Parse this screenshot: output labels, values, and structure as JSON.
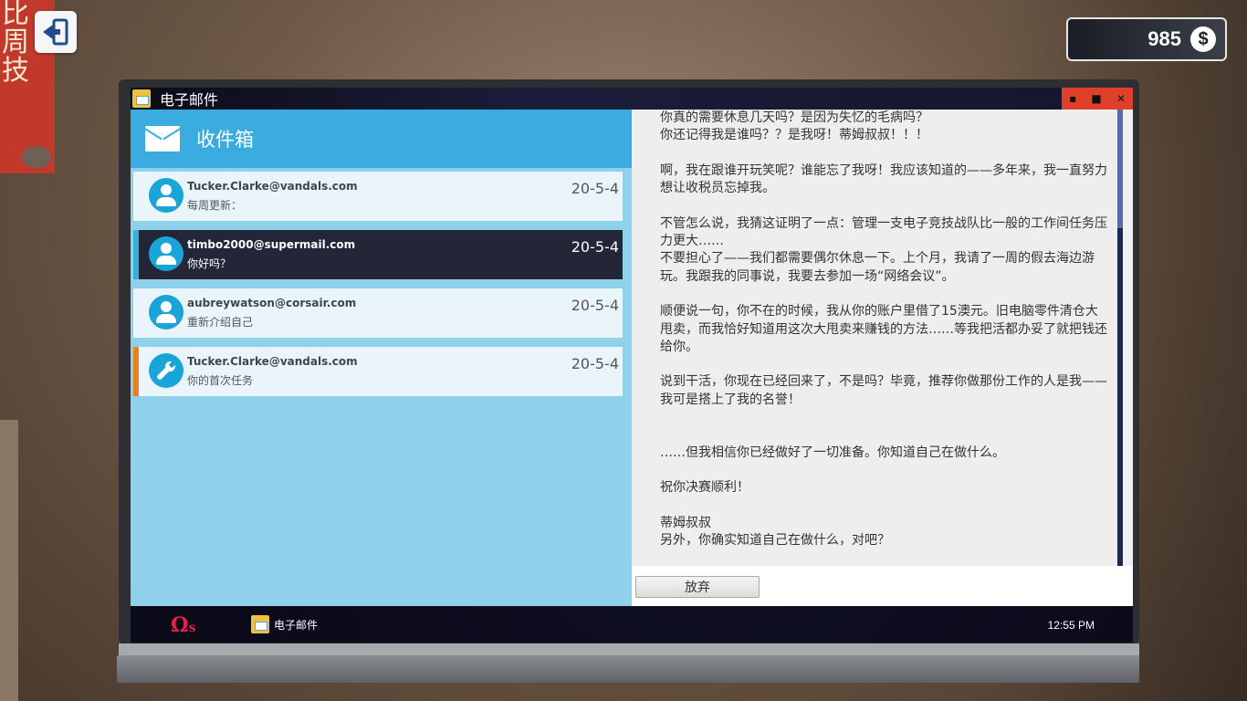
{
  "hud": {
    "money": "985",
    "money_icon": "dollar-coin-icon",
    "exit_icon": "exit-door-icon"
  },
  "wall_poster": {
    "text": "比\n周\n技"
  },
  "window": {
    "title": "电子邮件",
    "controls": [
      "minimize",
      "maximize",
      "close"
    ],
    "minimize_glyph": "▪",
    "maximize_glyph": "■",
    "close_glyph": "✕"
  },
  "inbox": {
    "title": "收件箱",
    "items": [
      {
        "from": "Tucker.Clarke@vandals.com",
        "subject": "每周更新：",
        "date": "20-5-4",
        "icon": "person-icon",
        "accent": ""
      },
      {
        "from": "timbo2000@supermail.com",
        "subject": "你好吗？",
        "date": "20-5-4",
        "icon": "person-icon",
        "accent": "#3aace0"
      },
      {
        "from": "aubreywatson@corsair.com",
        "subject": "重新介绍自己",
        "date": "20-5-4",
        "icon": "person-icon",
        "accent": ""
      },
      {
        "from": "Tucker.Clarke@vandals.com",
        "subject": "你的首次任务",
        "date": "20-5-4",
        "icon": "wrench-icon",
        "accent": "#e8821e"
      }
    ]
  },
  "reader": {
    "body": "你真的需要休息几天吗？是因为失忆的毛病吗？\n你还记得我是谁吗？？是我呀！蒂姆叔叔！！！\n\n啊，我在跟谁开玩笑呢？谁能忘了我呀！我应该知道的——多年来，我一直努力想让收税员忘掉我。\n\n不管怎么说，我猜这证明了一点：管理一支电子竞技战队比一般的工作间任务压力更大……\n不要担心了——我们都需要偶尔休息一下。上个月，我请了一周的假去海边游玩。我跟我的同事说，我要去参加一场“网络会议”。\n\n顺便说一句，你不在的时候，我从你的账户里借了15澳元。旧电脑零件清仓大甩卖，而我恰好知道用这次大甩卖来赚钱的方法……等我把活都办妥了就把钱还给你。\n\n说到干活，你现在已经回来了，不是吗？毕竟，推荐你做那份工作的人是我——我可是搭上了我的名誉！\n\n\n……但我相信你已经做好了一切准备。你知道自己在做什么。\n\n祝你决赛顺利！\n\n蒂姆叔叔\n另外，你确实知道自己在做什么，对吧？",
    "discard_label": "放弃"
  },
  "taskbar": {
    "logo_main": "Ω",
    "logo_sub": "s",
    "task_label": "电子邮件",
    "clock": "12:55 PM"
  }
}
